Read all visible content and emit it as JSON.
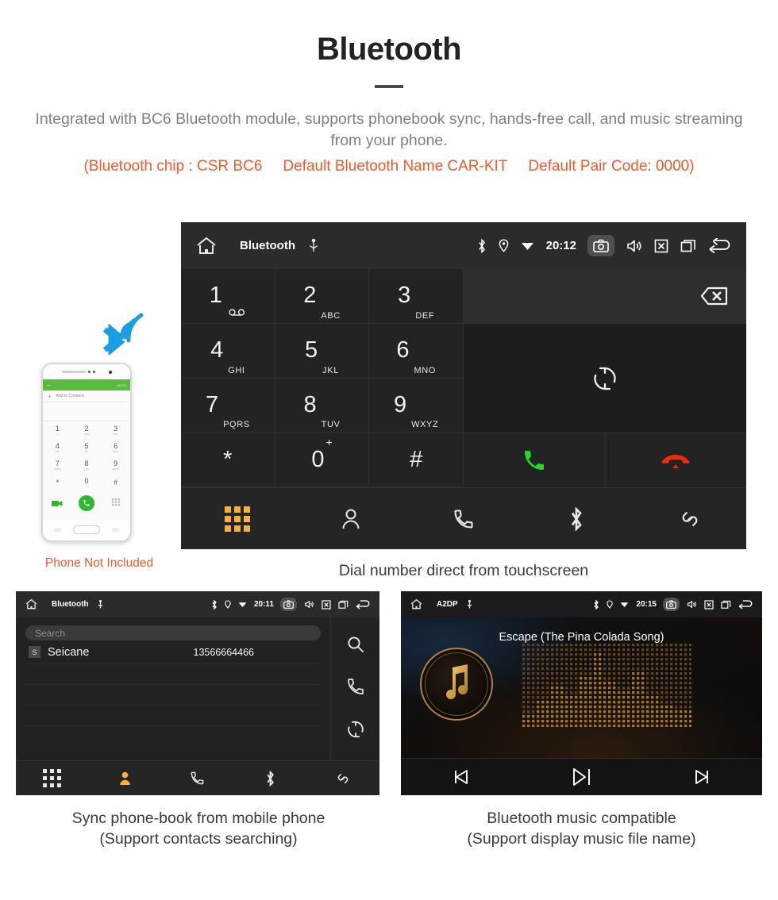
{
  "header": {
    "title": "Bluetooth",
    "subtitle": "Integrated with BC6 Bluetooth module, supports phonebook sync, hands-free call, and music streaming from your phone.",
    "spec_chip": "(Bluetooth chip : CSR BC6",
    "spec_name": "Default Bluetooth Name CAR-KIT",
    "spec_pair": "Default Pair Code: 0000)",
    "accent_color": "#f05a28",
    "body_color": "#808080"
  },
  "phone_mock": {
    "note": "Phone Not Included",
    "app_more": "MORE",
    "add_contacts": "Add to Contacts",
    "keys": [
      {
        "num": "1",
        "sub": "∞"
      },
      {
        "num": "2",
        "sub": "ABC"
      },
      {
        "num": "3",
        "sub": "DEF"
      },
      {
        "num": "4",
        "sub": "GHI"
      },
      {
        "num": "5",
        "sub": "JKL"
      },
      {
        "num": "6",
        "sub": "MNO"
      },
      {
        "num": "7",
        "sub": "PQRS"
      },
      {
        "num": "8",
        "sub": "TUV"
      },
      {
        "num": "9",
        "sub": "WXYZ"
      },
      {
        "num": "*",
        "sub": ""
      },
      {
        "num": "0",
        "sub": "+"
      },
      {
        "num": "#",
        "sub": ""
      }
    ]
  },
  "dialer": {
    "caption": "Dial number direct from touchscreen",
    "statusbar": {
      "title": "Bluetooth",
      "clock": "20:12",
      "icons_left": [
        "home-icon",
        "usb-icon"
      ],
      "icons_right": [
        "bluetooth-icon",
        "location-icon",
        "wifi-icon",
        "camera-icon",
        "volume-icon",
        "close-box-icon",
        "recent-apps-icon",
        "back-icon"
      ]
    },
    "keys": [
      {
        "num": "1",
        "sub": "",
        "voicemail": true
      },
      {
        "num": "2",
        "sub": "ABC"
      },
      {
        "num": "3",
        "sub": "DEF"
      },
      {
        "num": "4",
        "sub": "GHI"
      },
      {
        "num": "5",
        "sub": "JKL"
      },
      {
        "num": "6",
        "sub": "MNO"
      },
      {
        "num": "7",
        "sub": "PQRS"
      },
      {
        "num": "8",
        "sub": "TUV"
      },
      {
        "num": "9",
        "sub": "WXYZ"
      },
      {
        "num": "*",
        "sub": ""
      },
      {
        "num": "0",
        "sup": "+"
      },
      {
        "num": "#",
        "sub": ""
      }
    ],
    "actions": {
      "backspace": "backspace-icon",
      "sync": "sync-icon",
      "call": "call-icon",
      "hangup": "hangup-icon",
      "call_color": "#1fd925",
      "hangup_color": "#ef2b0c"
    },
    "tabs": [
      {
        "name": "keypad",
        "active": true
      },
      {
        "name": "contacts",
        "active": false
      },
      {
        "name": "call-log",
        "active": false
      },
      {
        "name": "bluetooth",
        "active": false
      },
      {
        "name": "pair",
        "active": false
      }
    ],
    "active_tab_color": "#f2b23e"
  },
  "phonebook": {
    "caption_line1": "Sync phone-book from mobile phone",
    "caption_line2": "(Support contacts searching)",
    "statusbar": {
      "title": "Bluetooth",
      "clock": "20:11"
    },
    "search_placeholder": "Search",
    "contacts": [
      {
        "initial": "S",
        "name": "Seicane",
        "number": "13566664466"
      }
    ],
    "side_icons": [
      "search-icon",
      "call-icon",
      "sync-icon"
    ],
    "tabs": [
      {
        "name": "keypad",
        "active": false
      },
      {
        "name": "contacts",
        "active": true
      },
      {
        "name": "call-log",
        "active": false
      },
      {
        "name": "bluetooth",
        "active": false
      },
      {
        "name": "pair",
        "active": false
      }
    ]
  },
  "music": {
    "caption_line1": "Bluetooth music compatible",
    "caption_line2": "(Support display music file name)",
    "statusbar": {
      "title": "A2DP",
      "clock": "20:15"
    },
    "song_title": "Escape (The Pina Colada Song)",
    "controls": [
      "previous-icon",
      "play-pause-icon",
      "next-icon"
    ],
    "accent_color": "#d09a3c"
  }
}
